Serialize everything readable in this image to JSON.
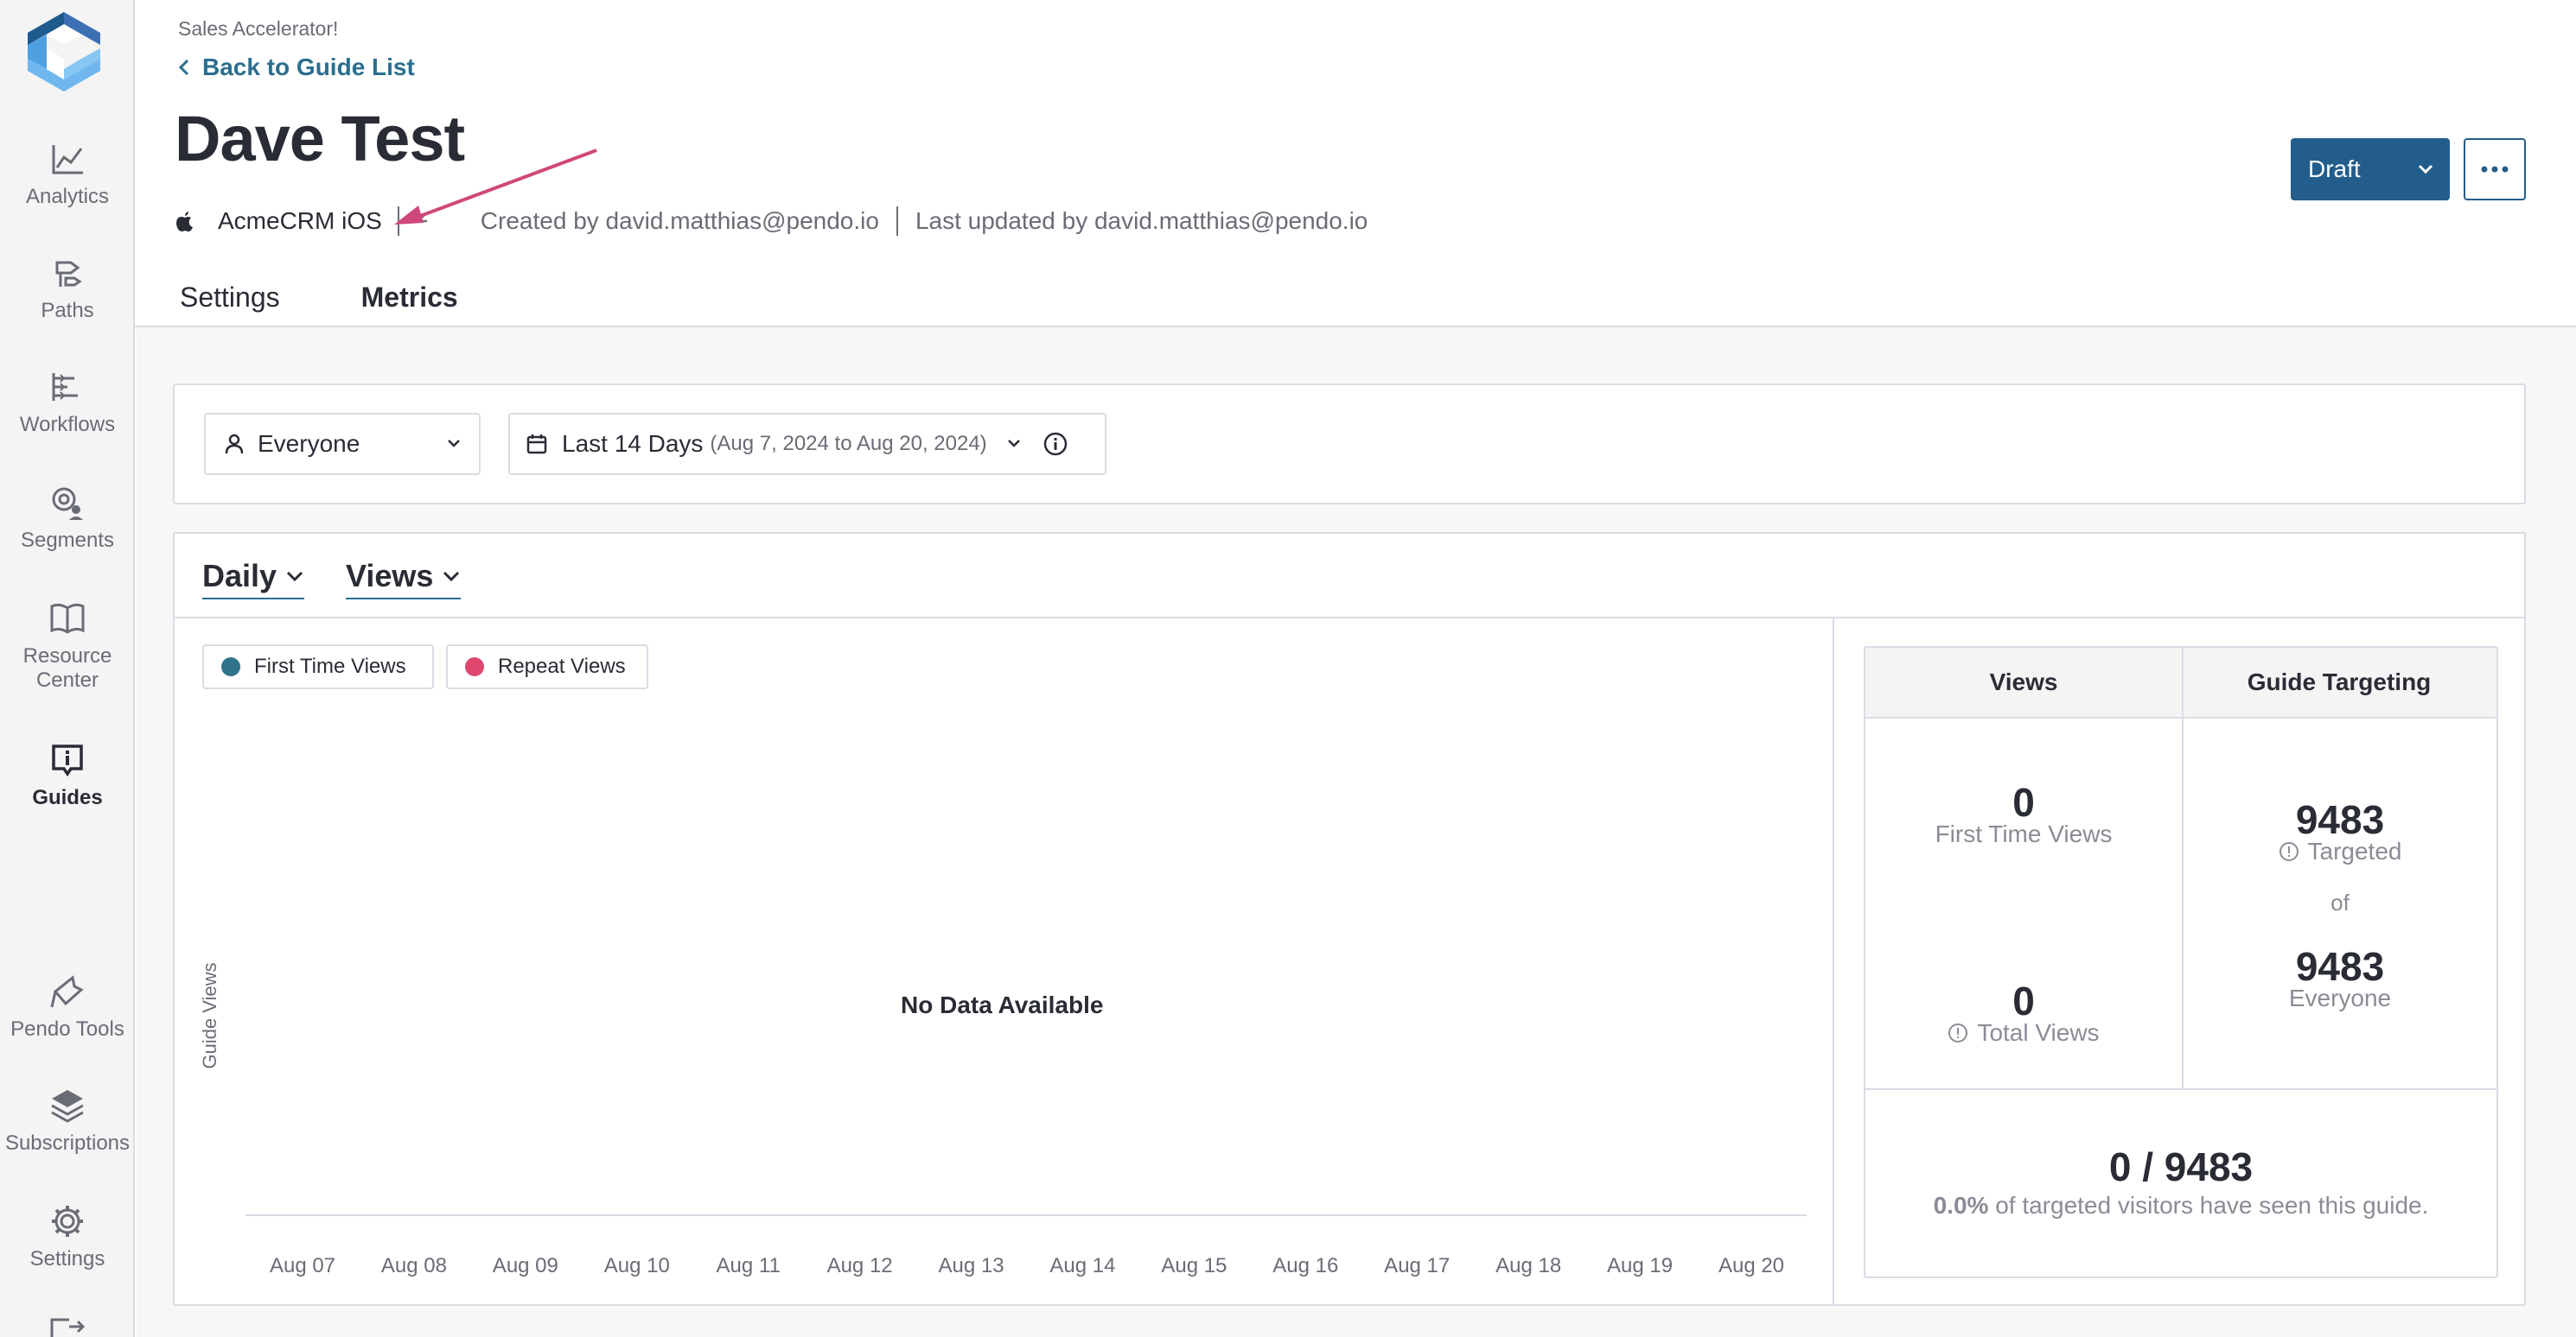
{
  "sidebar": {
    "items": [
      {
        "label": "Analytics",
        "icon": "analytics-icon"
      },
      {
        "label": "Paths",
        "icon": "paths-icon"
      },
      {
        "label": "Workflows",
        "icon": "workflows-icon"
      },
      {
        "label": "Segments",
        "icon": "segments-icon"
      },
      {
        "label": "Resource Center",
        "icon": "book-icon"
      },
      {
        "label": "Guides",
        "icon": "guides-icon",
        "active": true
      },
      {
        "label": "Pendo Tools",
        "icon": "pin-icon"
      },
      {
        "label": "Subscriptions",
        "icon": "layers-icon"
      },
      {
        "label": "Settings",
        "icon": "gear-icon"
      }
    ]
  },
  "header": {
    "breadcrumb": "Sales Accelerator!",
    "back_label": "Back to Guide List",
    "title": "Dave Test",
    "app_name": "AcmeCRM iOS",
    "created_by": "Created by david.matthias@pendo.io",
    "updated_by": "Last updated by david.matthias@pendo.io",
    "status_button": "Draft"
  },
  "tabs": [
    {
      "label": "Settings",
      "active": false
    },
    {
      "label": "Metrics",
      "active": true
    }
  ],
  "filters": {
    "segment": "Everyone",
    "date_range": "Last 14 Days",
    "date_range_detail": "(Aug 7, 2024 to Aug 20, 2024)"
  },
  "metrics": {
    "interval": "Daily",
    "measure": "Views",
    "legend": [
      {
        "label": "First Time Views",
        "color": "#2f7489"
      },
      {
        "label": "Repeat Views",
        "color": "#e0476f"
      }
    ],
    "empty_message": "No Data Available"
  },
  "chart_data": {
    "type": "bar",
    "title": "",
    "xlabel": "",
    "ylabel": "Guide Views",
    "categories": [
      "Aug 07",
      "Aug 08",
      "Aug 09",
      "Aug 10",
      "Aug 11",
      "Aug 12",
      "Aug 13",
      "Aug 14",
      "Aug 15",
      "Aug 16",
      "Aug 17",
      "Aug 18",
      "Aug 19",
      "Aug 20"
    ],
    "series": [
      {
        "name": "First Time Views",
        "values": []
      },
      {
        "name": "Repeat Views",
        "values": []
      }
    ],
    "legend_position": "top-left",
    "grid": false
  },
  "stats": {
    "col_views": "Views",
    "col_targeting": "Guide Targeting",
    "first_time_views": "0",
    "first_time_views_label": "First Time Views",
    "total_views": "0",
    "total_views_label": "Total Views",
    "targeted": "9483",
    "targeted_label": "Targeted",
    "of_label": "of",
    "everyone": "9483",
    "everyone_label": "Everyone",
    "summary": "0 / 9483",
    "summary_pct": "0.0%",
    "summary_text": "of targeted visitors have seen this guide."
  }
}
